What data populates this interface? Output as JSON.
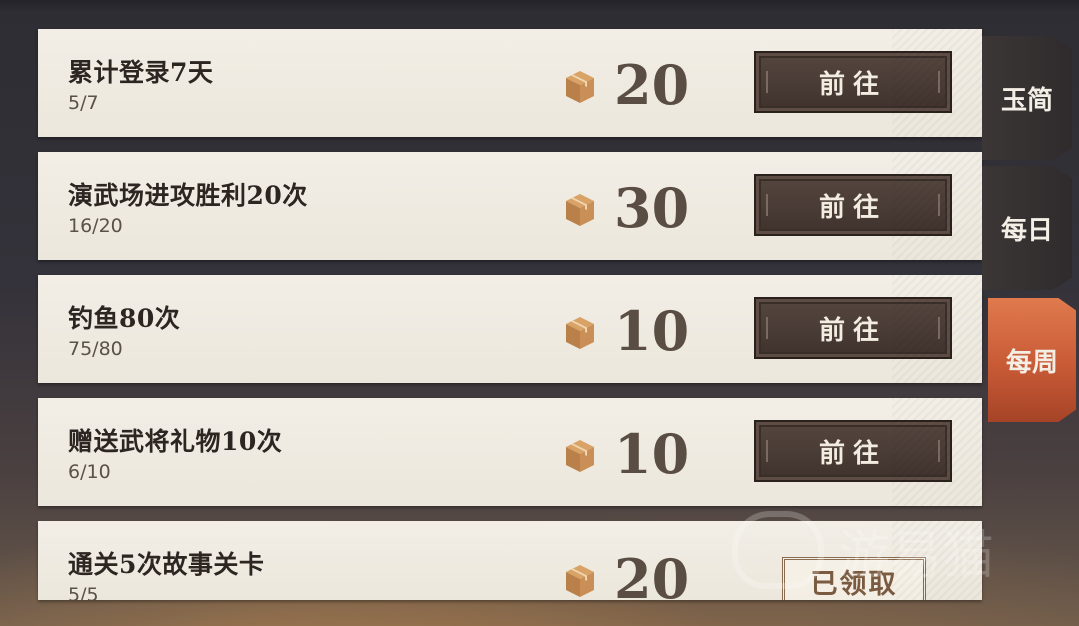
{
  "tabs": [
    {
      "label": "玉简",
      "active": false
    },
    {
      "label": "每日",
      "active": false
    },
    {
      "label": "每周",
      "active": true
    }
  ],
  "reward_icon": "gift-box-icon",
  "tasks": [
    {
      "title": "累计登录7天",
      "progress": "5/7",
      "reward": "20",
      "action": "前往",
      "claimed": false
    },
    {
      "title": "演武场进攻胜利20次",
      "progress": "16/20",
      "reward": "30",
      "action": "前往",
      "claimed": false
    },
    {
      "title": "钓鱼80次",
      "progress": "75/80",
      "reward": "10",
      "action": "前往",
      "claimed": false
    },
    {
      "title": "赠送武将礼物10次",
      "progress": "6/10",
      "reward": "10",
      "action": "前往",
      "claimed": false
    },
    {
      "title": "通关5次故事关卡",
      "progress": "5/5",
      "reward": "20",
      "action": "已领取",
      "claimed": true
    }
  ],
  "watermark": "游易猫",
  "colors": {
    "active_tab": "#d0613b",
    "button": "#4a3c35",
    "row_bg": "#efebe2"
  }
}
